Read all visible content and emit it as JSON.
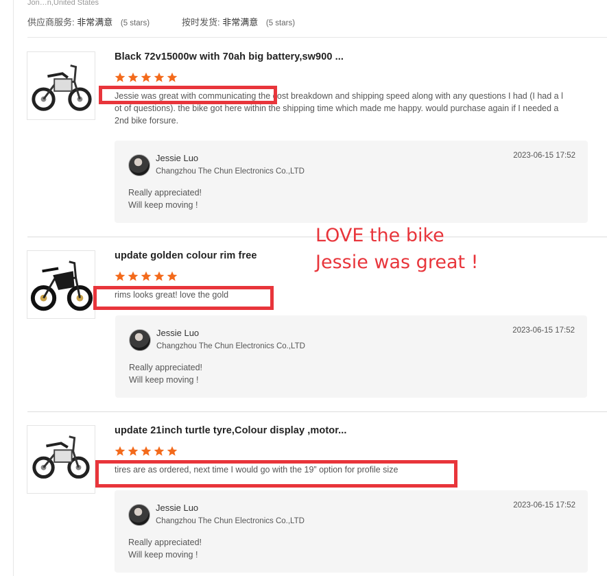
{
  "header": {
    "buyer": "Jon…n,United States",
    "supplier_service_label": "供应商服务:",
    "supplier_service_value": "非常满意",
    "supplier_service_stars": "(5 stars)",
    "ontime_label": "按时发货:",
    "ontime_value": "非常满意",
    "ontime_stars": "(5 stars)"
  },
  "colors": {
    "star": "#f36a1b",
    "highlight": "#e8353b",
    "annotation": "#e8353b"
  },
  "reviews": [
    {
      "product_title": "Black 72v15000w with 70ah big battery,sw900 ...",
      "rating": 5,
      "text": "Jessie was great with communicating the cost breakdown and shipping speed along with any questions I had (I had a lot of questions). the bike got here within the shipping time which made me happy. would purchase again if I needed a 2nd bike forsure.",
      "reply": {
        "name": "Jessie Luo",
        "company": "Changzhou The Chun Electronics Co.,LTD",
        "date": "2023-06-15 17:52",
        "line1": "Really appreciated!",
        "line2": "Will keep moving !"
      }
    },
    {
      "product_title": "update golden colour rim free",
      "rating": 5,
      "text": "rims looks great! love the gold",
      "reply": {
        "name": "Jessie Luo",
        "company": "Changzhou The Chun Electronics Co.,LTD",
        "date": "2023-06-15 17:52",
        "line1": "Really appreciated!",
        "line2": "Will keep moving !"
      }
    },
    {
      "product_title": "update 21inch turtle tyre,Colour display ,motor...",
      "rating": 5,
      "text": "tires are as ordered, next time I would go with the 19” option for profile size",
      "reply": {
        "name": "Jessie Luo",
        "company": "Changzhou The Chun Electronics Co.,LTD",
        "date": "2023-06-15 17:52",
        "line1": "Really appreciated!",
        "line2": "Will keep moving !"
      }
    }
  ],
  "annotation": {
    "line1": "LOVE the bike",
    "line2": "Jessie was great !"
  }
}
